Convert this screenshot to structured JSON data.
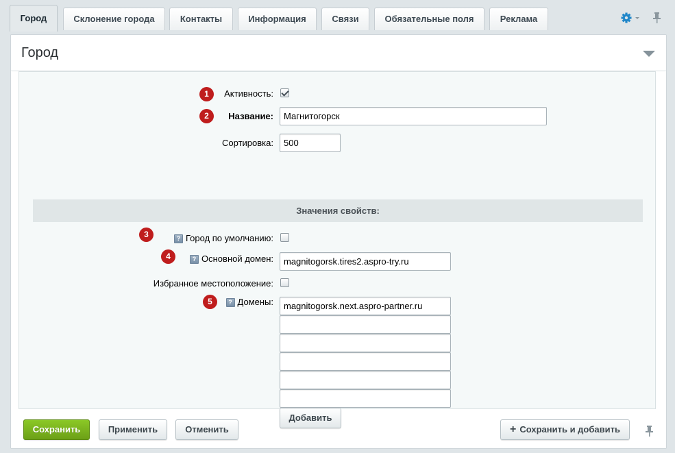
{
  "tabs": [
    {
      "label": "Город",
      "active": true
    },
    {
      "label": "Склонение города",
      "active": false
    },
    {
      "label": "Контакты",
      "active": false
    },
    {
      "label": "Информация",
      "active": false
    },
    {
      "label": "Связи",
      "active": false
    },
    {
      "label": "Обязательные поля",
      "active": false
    },
    {
      "label": "Реклама",
      "active": false
    }
  ],
  "panel": {
    "title": "Город"
  },
  "form": {
    "active": {
      "label": "Активность:",
      "checked": true,
      "badge": "1"
    },
    "name": {
      "label": "Название:",
      "value": "Магнитогорск",
      "badge": "2"
    },
    "sort": {
      "label": "Сортировка:",
      "value": "500"
    },
    "section_title": "Значения свойств:",
    "default_city": {
      "label": "Город по умолчанию:",
      "checked": false,
      "badge": "3"
    },
    "main_domain": {
      "label": "Основной домен:",
      "value": "magnitogorsk.tires2.aspro-try.ru",
      "badge": "4"
    },
    "favorite_location": {
      "label": "Избранное местоположение:",
      "checked": false
    },
    "domains": {
      "label": "Домены:",
      "badge": "5",
      "values": [
        "magnitogorsk.next.aspro-partner.ru",
        "",
        "",
        "",
        "",
        ""
      ],
      "add_label": "Добавить"
    },
    "help_icon": "?"
  },
  "footer": {
    "save": "Сохранить",
    "apply": "Применить",
    "cancel": "Отменить",
    "save_add": "Сохранить и добавить",
    "save_add_icon": "+"
  },
  "colors": {
    "accent_green": "#7ab41d",
    "badge_red": "#bf1d1d",
    "settings_blue": "#1f86c9"
  }
}
